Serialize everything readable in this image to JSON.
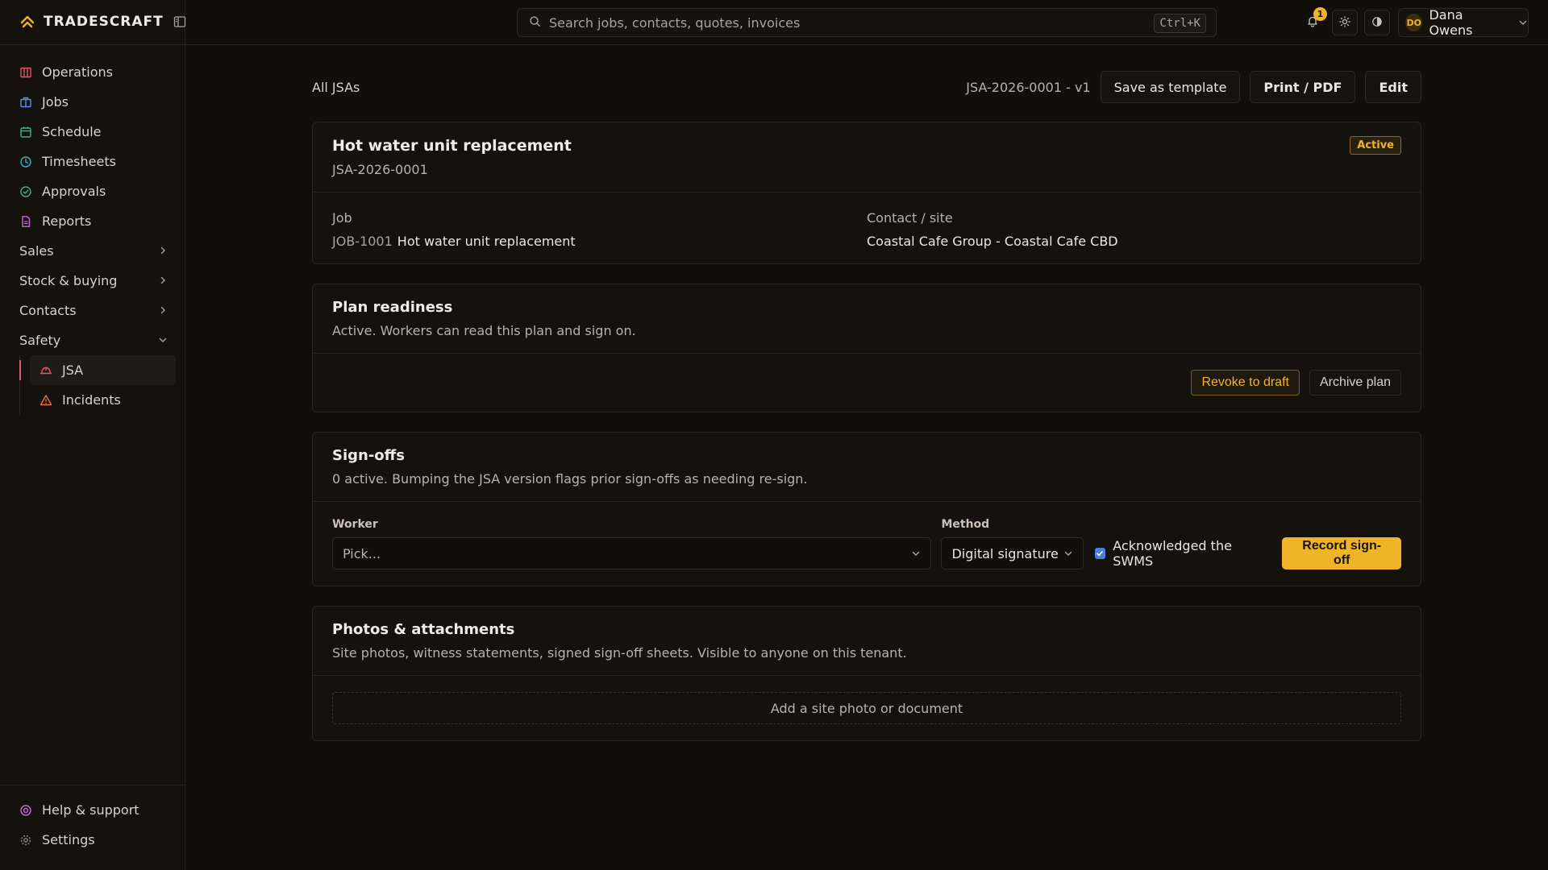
{
  "brand": {
    "name": "TRADESCRAFT"
  },
  "colors": {
    "accent": "#f0b429",
    "background": "#120f0b",
    "checkbox": "#4a80d8"
  },
  "sidebar": {
    "items": [
      {
        "label": "Operations",
        "icon": "operations-icon",
        "color": "#e0566a"
      },
      {
        "label": "Jobs",
        "icon": "jobs-icon",
        "color": "#5b8def"
      },
      {
        "label": "Schedule",
        "icon": "calendar-icon",
        "color": "#3fb57a"
      },
      {
        "label": "Timesheets",
        "icon": "clock-icon",
        "color": "#3ab0c8"
      },
      {
        "label": "Approvals",
        "icon": "check-circle-icon",
        "color": "#3fb57a"
      },
      {
        "label": "Reports",
        "icon": "document-icon",
        "color": "#c86ad8"
      }
    ],
    "groups": [
      {
        "label": "Sales",
        "expanded": false
      },
      {
        "label": "Stock & buying",
        "expanded": false
      },
      {
        "label": "Contacts",
        "expanded": false
      },
      {
        "label": "Safety",
        "expanded": true
      }
    ],
    "safety_items": [
      {
        "label": "JSA",
        "icon": "hardhat-icon",
        "active": true
      },
      {
        "label": "Incidents",
        "icon": "warning-icon",
        "active": false
      }
    ],
    "bottom": [
      {
        "label": "Help & support",
        "icon": "help-icon"
      },
      {
        "label": "Settings",
        "icon": "gear-icon"
      }
    ]
  },
  "topbar": {
    "search_placeholder": "Search jobs, contacts, quotes, invoices",
    "shortcut": "Ctrl+K",
    "notification_count": "1",
    "user": {
      "initials": "DO",
      "name": "Dana Owens"
    }
  },
  "page": {
    "breadcrumb": "All JSAs",
    "doc_version": "JSA-2026-0001 - v1",
    "actions": {
      "save_template": "Save as template",
      "print": "Print / PDF",
      "edit": "Edit"
    }
  },
  "summary": {
    "title": "Hot water unit replacement",
    "id": "JSA-2026-0001",
    "status": "Active",
    "job_label": "Job",
    "job_code": "JOB-1001",
    "job_name": "Hot water unit replacement",
    "contact_label": "Contact / site",
    "contact_value": "Coastal Cafe Group - Coastal Cafe CBD"
  },
  "readiness": {
    "title": "Plan readiness",
    "subtitle": "Active. Workers can read this plan and sign on.",
    "revoke_label": "Revoke to draft",
    "archive_label": "Archive plan"
  },
  "signoffs": {
    "title": "Sign-offs",
    "subtitle": "0 active. Bumping the JSA version flags prior sign-offs as needing re-sign.",
    "worker_label": "Worker",
    "worker_value": "Pick...",
    "method_label": "Method",
    "method_value": "Digital signature",
    "ack_label": "Acknowledged the SWMS",
    "ack_checked": true,
    "record_label": "Record sign-off"
  },
  "attachments": {
    "title": "Photos & attachments",
    "subtitle": "Site photos, witness statements, signed sign-off sheets. Visible to anyone on this tenant.",
    "add_label": "Add a site photo or document"
  }
}
